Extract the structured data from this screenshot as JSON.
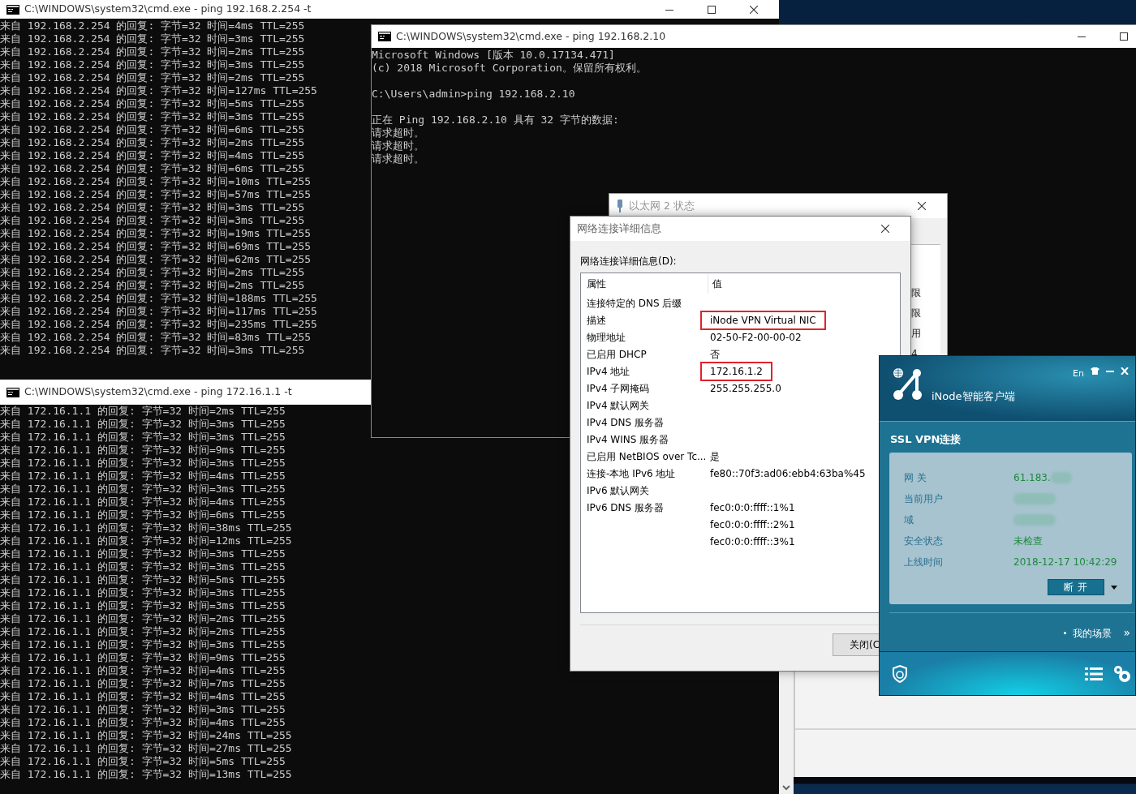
{
  "console_top": {
    "title": "C:\\WINDOWS\\system32\\cmd.exe - ping 192.168.2.254 -t",
    "lines": [
      "来自 192.168.2.254 的回复: 字节=32 时间=4ms TTL=255",
      "来自 192.168.2.254 的回复: 字节=32 时间=3ms TTL=255",
      "来自 192.168.2.254 的回复: 字节=32 时间=2ms TTL=255",
      "来自 192.168.2.254 的回复: 字节=32 时间=3ms TTL=255",
      "来自 192.168.2.254 的回复: 字节=32 时间=2ms TTL=255",
      "来自 192.168.2.254 的回复: 字节=32 时间=127ms TTL=255",
      "来自 192.168.2.254 的回复: 字节=32 时间=5ms TTL=255",
      "来自 192.168.2.254 的回复: 字节=32 时间=3ms TTL=255",
      "来自 192.168.2.254 的回复: 字节=32 时间=6ms TTL=255",
      "来自 192.168.2.254 的回复: 字节=32 时间=2ms TTL=255",
      "来自 192.168.2.254 的回复: 字节=32 时间=4ms TTL=255",
      "来自 192.168.2.254 的回复: 字节=32 时间=6ms TTL=255",
      "来自 192.168.2.254 的回复: 字节=32 时间=10ms TTL=255",
      "来自 192.168.2.254 的回复: 字节=32 时间=57ms TTL=255",
      "来自 192.168.2.254 的回复: 字节=32 时间=3ms TTL=255",
      "来自 192.168.2.254 的回复: 字节=32 时间=3ms TTL=255",
      "来自 192.168.2.254 的回复: 字节=32 时间=19ms TTL=255",
      "来自 192.168.2.254 的回复: 字节=32 时间=69ms TTL=255",
      "来自 192.168.2.254 的回复: 字节=32 时间=62ms TTL=255",
      "来自 192.168.2.254 的回复: 字节=32 时间=2ms TTL=255",
      "来自 192.168.2.254 的回复: 字节=32 时间=2ms TTL=255",
      "来自 192.168.2.254 的回复: 字节=32 时间=188ms TTL=255",
      "来自 192.168.2.254 的回复: 字节=32 时间=117ms TTL=255",
      "来自 192.168.2.254 的回复: 字节=32 时间=235ms TTL=255",
      "来自 192.168.2.254 的回复: 字节=32 时间=83ms TTL=255",
      "来自 192.168.2.254 的回复: 字节=32 时间=3ms TTL=255"
    ]
  },
  "console_bottom": {
    "title": "C:\\WINDOWS\\system32\\cmd.exe - ping 172.16.1.1 -t",
    "lines": [
      "来自 172.16.1.1 的回复: 字节=32 时间=2ms TTL=255",
      "来自 172.16.1.1 的回复: 字节=32 时间=3ms TTL=255",
      "来自 172.16.1.1 的回复: 字节=32 时间=3ms TTL=255",
      "来自 172.16.1.1 的回复: 字节=32 时间=9ms TTL=255",
      "来自 172.16.1.1 的回复: 字节=32 时间=3ms TTL=255",
      "来自 172.16.1.1 的回复: 字节=32 时间=4ms TTL=255",
      "来自 172.16.1.1 的回复: 字节=32 时间=3ms TTL=255",
      "来自 172.16.1.1 的回复: 字节=32 时间=4ms TTL=255",
      "来自 172.16.1.1 的回复: 字节=32 时间=6ms TTL=255",
      "来自 172.16.1.1 的回复: 字节=32 时间=38ms TTL=255",
      "来自 172.16.1.1 的回复: 字节=32 时间=12ms TTL=255",
      "来自 172.16.1.1 的回复: 字节=32 时间=3ms TTL=255",
      "来自 172.16.1.1 的回复: 字节=32 时间=3ms TTL=255",
      "来自 172.16.1.1 的回复: 字节=32 时间=5ms TTL=255",
      "来自 172.16.1.1 的回复: 字节=32 时间=3ms TTL=255",
      "来自 172.16.1.1 的回复: 字节=32 时间=3ms TTL=255",
      "来自 172.16.1.1 的回复: 字节=32 时间=2ms TTL=255",
      "来自 172.16.1.1 的回复: 字节=32 时间=2ms TTL=255",
      "来自 172.16.1.1 的回复: 字节=32 时间=3ms TTL=255",
      "来自 172.16.1.1 的回复: 字节=32 时间=9ms TTL=255",
      "来自 172.16.1.1 的回复: 字节=32 时间=4ms TTL=255",
      "来自 172.16.1.1 的回复: 字节=32 时间=7ms TTL=255",
      "来自 172.16.1.1 的回复: 字节=32 时间=4ms TTL=255",
      "来自 172.16.1.1 的回复: 字节=32 时间=3ms TTL=255",
      "来自 172.16.1.1 的回复: 字节=32 时间=4ms TTL=255",
      "来自 172.16.1.1 的回复: 字节=32 时间=24ms TTL=255",
      "来自 172.16.1.1 的回复: 字节=32 时间=27ms TTL=255",
      "来自 172.16.1.1 的回复: 字节=32 时间=5ms TTL=255",
      "来自 172.16.1.1 的回复: 字节=32 时间=13ms TTL=255"
    ]
  },
  "console_front": {
    "title": "C:\\WINDOWS\\system32\\cmd.exe - ping 192.168.2.10",
    "paragraphs": [
      [
        "Microsoft Windows [版本 10.0.17134.471]",
        "(c) 2018 Microsoft Corporation。保留所有权利。"
      ],
      [
        "C:\\Users\\admin>ping 192.168.2.10"
      ],
      [
        "正在 Ping 192.168.2.10 具有 32 字节的数据:",
        "请求超时。",
        "请求超时。",
        "请求超时。"
      ]
    ]
  },
  "status_window": {
    "title": "以太网 2 状态",
    "partial_labels": [
      "限",
      "限",
      "用",
      "4"
    ]
  },
  "details_dialog": {
    "title": "网络连接详细信息",
    "list_label": "网络连接详细信息(D):",
    "columns": [
      "属性",
      "值"
    ],
    "rows": [
      {
        "property": "连接特定的 DNS 后缀",
        "highlighted": false
      },
      {
        "property": "描述",
        "value": "iNode VPN Virtual NIC",
        "highlighted": true
      },
      {
        "property": "物理地址",
        "value": "02-50-F2-00-00-02",
        "highlighted": false
      },
      {
        "property": "已启用 DHCP",
        "value": "否",
        "highlighted": false
      },
      {
        "property": "IPv4 地址",
        "value": "172.16.1.2",
        "highlighted": true
      },
      {
        "property": "IPv4 子网掩码",
        "value": "255.255.255.0",
        "highlighted": false
      },
      {
        "property": "IPv4 默认网关",
        "highlighted": false
      },
      {
        "property": "IPv4 DNS 服务器",
        "highlighted": false
      },
      {
        "property": "IPv4 WINS 服务器",
        "highlighted": false
      },
      {
        "property": "已启用 NetBIOS over Tc...",
        "value": "是",
        "highlighted": false
      },
      {
        "property": "连接-本地 IPv6 地址",
        "value": "fe80::70f3:ad06:ebb4:63ba%45",
        "highlighted": false
      },
      {
        "property": "IPv6 默认网关",
        "highlighted": false
      },
      {
        "property": "IPv6 DNS 服务器",
        "value": "fec0:0:0:ffff::1%1",
        "highlighted": false
      },
      {
        "value": "fec0:0:0:ffff::2%1",
        "highlighted": false
      },
      {
        "value": "fec0:0:0:ffff::3%1",
        "highlighted": false
      }
    ],
    "close_button": "关闭(C"
  },
  "inode": {
    "title": "iNode智能客户端",
    "language": "En",
    "section": "SSL VPN连接",
    "fields": [
      {
        "label": "网 关",
        "value": "61.183.",
        "redacted": true
      },
      {
        "label": "当前用户",
        "redacted": true
      },
      {
        "label": "域",
        "redacted": true
      },
      {
        "label": "安全状态",
        "value": "未检查",
        "redacted": false
      },
      {
        "label": "上线时间",
        "value": "2018-12-17 10:42:29",
        "redacted": false
      }
    ],
    "disconnect_button": "断 开",
    "scenes_link": "我的场景",
    "more_glyph": "»"
  }
}
